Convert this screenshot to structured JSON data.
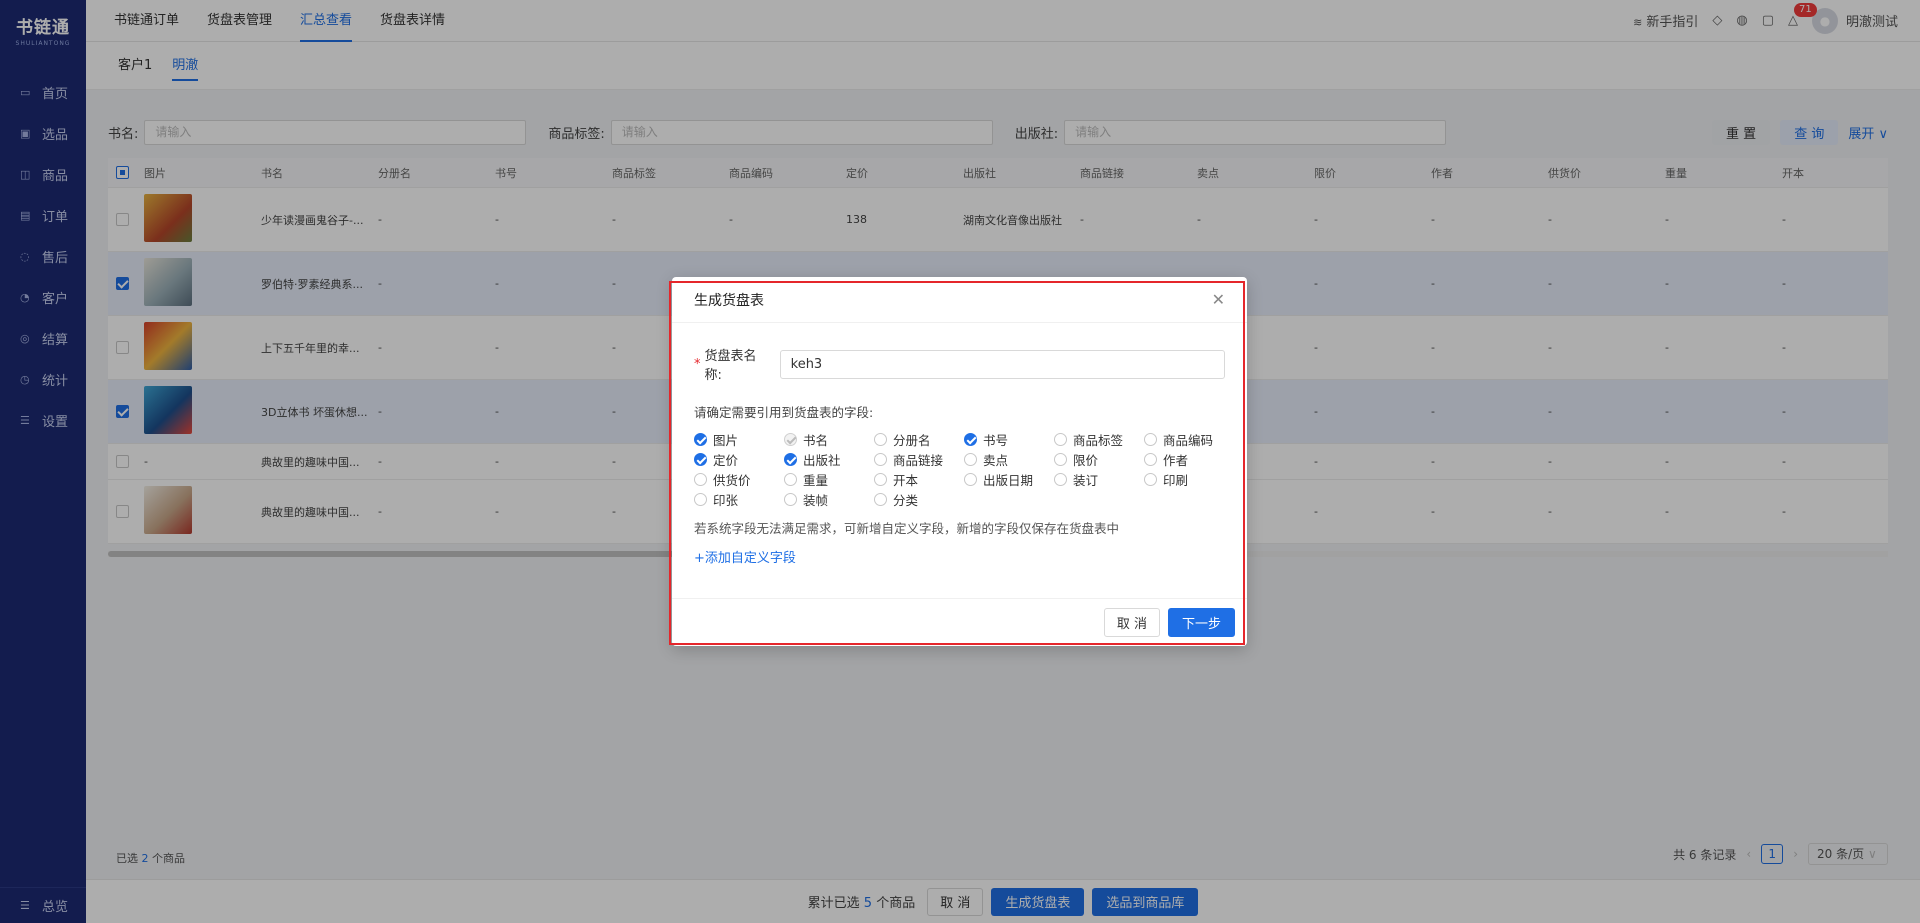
{
  "sidebar": {
    "logo_title": "书链通",
    "logo_sub": "SHULIANTONG",
    "items": [
      {
        "label": "首页"
      },
      {
        "label": "选品"
      },
      {
        "label": "商品"
      },
      {
        "label": "订单"
      },
      {
        "label": "售后"
      },
      {
        "label": "客户"
      },
      {
        "label": "结算"
      },
      {
        "label": "统计"
      },
      {
        "label": "设置"
      }
    ],
    "footer_label": "总览"
  },
  "topnav": {
    "tabs": [
      {
        "label": "书链通订单"
      },
      {
        "label": "货盘表管理"
      },
      {
        "label": "汇总查看"
      },
      {
        "label": "货盘表详情"
      }
    ],
    "guide_label": "新手指引",
    "badge_count": "71",
    "user_name": "明澈测试"
  },
  "subtabs": [
    {
      "label": "客户1"
    },
    {
      "label": "明澈"
    }
  ],
  "filters": {
    "book_label": "书名:",
    "book_placeholder": "请输入",
    "tag_label": "商品标签:",
    "tag_placeholder": "请输入",
    "publisher_label": "出版社:",
    "publisher_placeholder": "请输入",
    "reset_label": "重 置",
    "query_label": "查 询",
    "expand_label": "展开"
  },
  "table": {
    "headers": [
      "图片",
      "书名",
      "分册名",
      "书号",
      "商品标签",
      "商品编码",
      "定价",
      "出版社",
      "商品链接",
      "卖点",
      "限价",
      "作者",
      "供货价",
      "重量",
      "开本"
    ],
    "rows": [
      {
        "title": "少年读漫画鬼谷子-...",
        "cells": [
          "-",
          "-",
          "-",
          "-",
          "138",
          "湖南文化音像出版社",
          "-",
          "-",
          "-",
          "-",
          "-",
          "-",
          "-"
        ]
      },
      {
        "title": "罗伯特·罗素经典系...",
        "cells": [
          "-",
          "-",
          "-",
          "-",
          "-",
          "-",
          "-",
          "-",
          "-",
          "-",
          "-",
          "-",
          "-"
        ]
      },
      {
        "title": "上下五千年里的幸...",
        "cells": [
          "-",
          "-",
          "-",
          "-",
          "-",
          "-",
          "-",
          "-",
          "-",
          "-",
          "-",
          "-",
          "-"
        ]
      },
      {
        "title": "3D立体书 坏蛋休想...",
        "cells": [
          "-",
          "-",
          "-",
          "-",
          "-",
          "-",
          "-",
          "-",
          "-",
          "-",
          "-",
          "-",
          "-"
        ]
      },
      {
        "title": "典故里的趣味中国...",
        "cells": [
          "-",
          "-",
          "-",
          "-",
          "-",
          "-",
          "-",
          "-",
          "-",
          "-",
          "-",
          "-",
          "-"
        ]
      },
      {
        "title": "典故里的趣味中国...",
        "cells": [
          "-",
          "-",
          "-",
          "-",
          "-",
          "-",
          "-",
          "-",
          "-",
          "-",
          "-",
          "-",
          "-"
        ]
      }
    ],
    "no_image_text": "-"
  },
  "selected_info": {
    "prefix": "已选",
    "count": "2",
    "suffix": "个商品"
  },
  "pager": {
    "total_text": "共 6 条记录",
    "page": "1",
    "page_size": "20 条/页"
  },
  "bottombar": {
    "sum_prefix": "累计已选",
    "sum_count": "5",
    "sum_suffix": "个商品",
    "cancel_label": "取 消",
    "generate_label": "生成货盘表",
    "to_library_label": "选品到商品库"
  },
  "modal": {
    "title": "生成货盘表",
    "name_label": "货盘表名称:",
    "name_value": "keh3",
    "hint": "请确定需要引用到货盘表的字段:",
    "fields": [
      {
        "label": "图片",
        "state": "on"
      },
      {
        "label": "书名",
        "state": "disabled"
      },
      {
        "label": "分册名",
        "state": "off"
      },
      {
        "label": "书号",
        "state": "on"
      },
      {
        "label": "商品标签",
        "state": "off"
      },
      {
        "label": "商品编码",
        "state": "off"
      },
      {
        "label": "定价",
        "state": "on"
      },
      {
        "label": "出版社",
        "state": "on"
      },
      {
        "label": "商品链接",
        "state": "off"
      },
      {
        "label": "卖点",
        "state": "off"
      },
      {
        "label": "限价",
        "state": "off"
      },
      {
        "label": "作者",
        "state": "off"
      },
      {
        "label": "供货价",
        "state": "off"
      },
      {
        "label": "重量",
        "state": "off"
      },
      {
        "label": "开本",
        "state": "off"
      },
      {
        "label": "出版日期",
        "state": "off"
      },
      {
        "label": "装订",
        "state": "off"
      },
      {
        "label": "印刷",
        "state": "off"
      },
      {
        "label": "印张",
        "state": "off"
      },
      {
        "label": "装帧",
        "state": "off"
      },
      {
        "label": "分类",
        "state": "off"
      }
    ],
    "note": "若系统字段无法满足需求，可新增自定义字段，新增的字段仅保存在货盘表中",
    "add_label": "+添加自定义字段",
    "cancel_label": "取 消",
    "next_label": "下一步"
  }
}
